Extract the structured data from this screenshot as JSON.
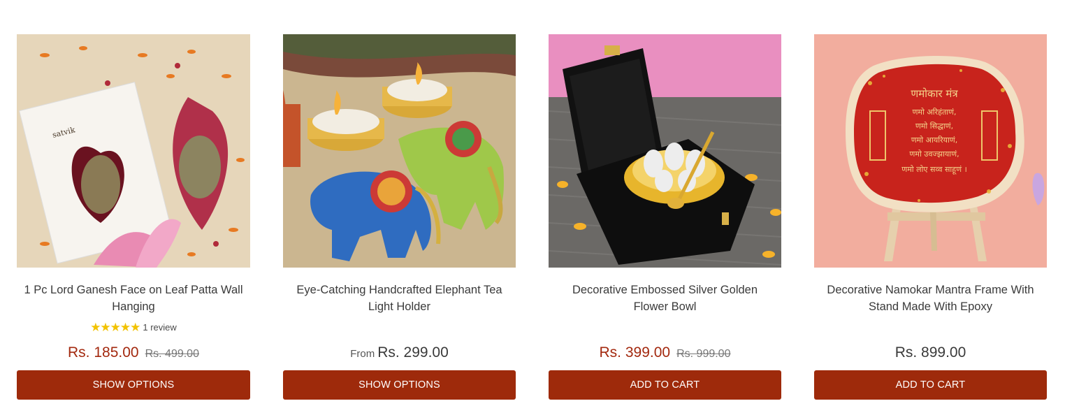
{
  "products": [
    {
      "title": "1 Pc Lord Ganesh Face on Leaf Patta Wall Hanging",
      "rating_stars": "★★★★★",
      "review_count": "1 review",
      "price_sale": "Rs. 185.00",
      "price_compare": "Rs. 499.00",
      "button_label": "SHOW OPTIONS",
      "packaging_brand": "satvik"
    },
    {
      "title": "Eye-Catching Handcrafted Elephant Tea Light Holder",
      "price_from_label": "From",
      "price_regular": "Rs. 299.00",
      "button_label": "SHOW OPTIONS"
    },
    {
      "title": "Decorative Embossed Silver Golden Flower Bowl",
      "price_sale": "Rs. 399.00",
      "price_compare": "Rs. 999.00",
      "button_label": "ADD TO CART"
    },
    {
      "title": "Decorative Namokar Mantra Frame With Stand Made With Epoxy",
      "price_regular": "Rs. 899.00",
      "button_label": "ADD TO CART",
      "frame_heading": "णमोकार मंत्र",
      "frame_lines": [
        "णमो अरिहंताणं,",
        "णमो सिद्धाणं,",
        "णमो आयरियाणं,",
        "णमो उवज्झायाणं,",
        "णमो लोए सव्व साहूणं ।"
      ]
    }
  ],
  "colors": {
    "button_bg": "#9e2a0b",
    "sale_price": "#a3290f",
    "star": "#f2c200"
  }
}
